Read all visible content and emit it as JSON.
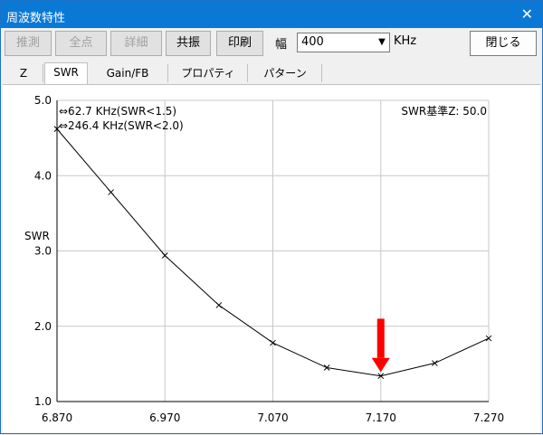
{
  "window": {
    "title": "周波数特性"
  },
  "toolbar": {
    "buttons": [
      {
        "label": "推測",
        "enabled": false
      },
      {
        "label": "全点",
        "enabled": false
      },
      {
        "label": "詳細",
        "enabled": false
      },
      {
        "label": "共振",
        "enabled": true
      },
      {
        "label": "印刷",
        "enabled": true
      }
    ],
    "width_label": "幅",
    "width_value": "400",
    "unit_label": "KHz",
    "close_button_label": "閉じる"
  },
  "tabs": [
    {
      "label": "Z",
      "active": false
    },
    {
      "label": "SWR",
      "active": true
    },
    {
      "label": "Gain/FB",
      "active": false
    },
    {
      "label": "プロパティ",
      "active": false
    },
    {
      "label": "パターン",
      "active": false
    }
  ],
  "chart_data": {
    "type": "line",
    "ylabel": "SWR",
    "xlabel": "",
    "xlim": [
      6.87,
      7.27
    ],
    "ylim": [
      1.0,
      5.0
    ],
    "x_ticks": [
      "6.870",
      "6.970",
      "7.070",
      "7.170",
      "7.270"
    ],
    "y_ticks": [
      "5.0",
      "4.0",
      "3.0",
      "2.0",
      "1.0"
    ],
    "annotations": [
      "⇔62.7 KHz(SWR<1.5)",
      "⇔246.4 KHz(SWR<2.0)",
      "SWR基準Z: 50.0"
    ],
    "grid": true,
    "series": [
      {
        "x": [
          6.87,
          6.92,
          6.97,
          7.02,
          7.07,
          7.12,
          7.17,
          7.22,
          7.27
        ],
        "y": [
          4.62,
          3.78,
          2.94,
          2.28,
          1.78,
          1.45,
          1.34,
          1.51,
          1.84
        ]
      }
    ],
    "marker": {
      "x": 7.17,
      "label": "arrow",
      "color": "#ff0000"
    }
  }
}
